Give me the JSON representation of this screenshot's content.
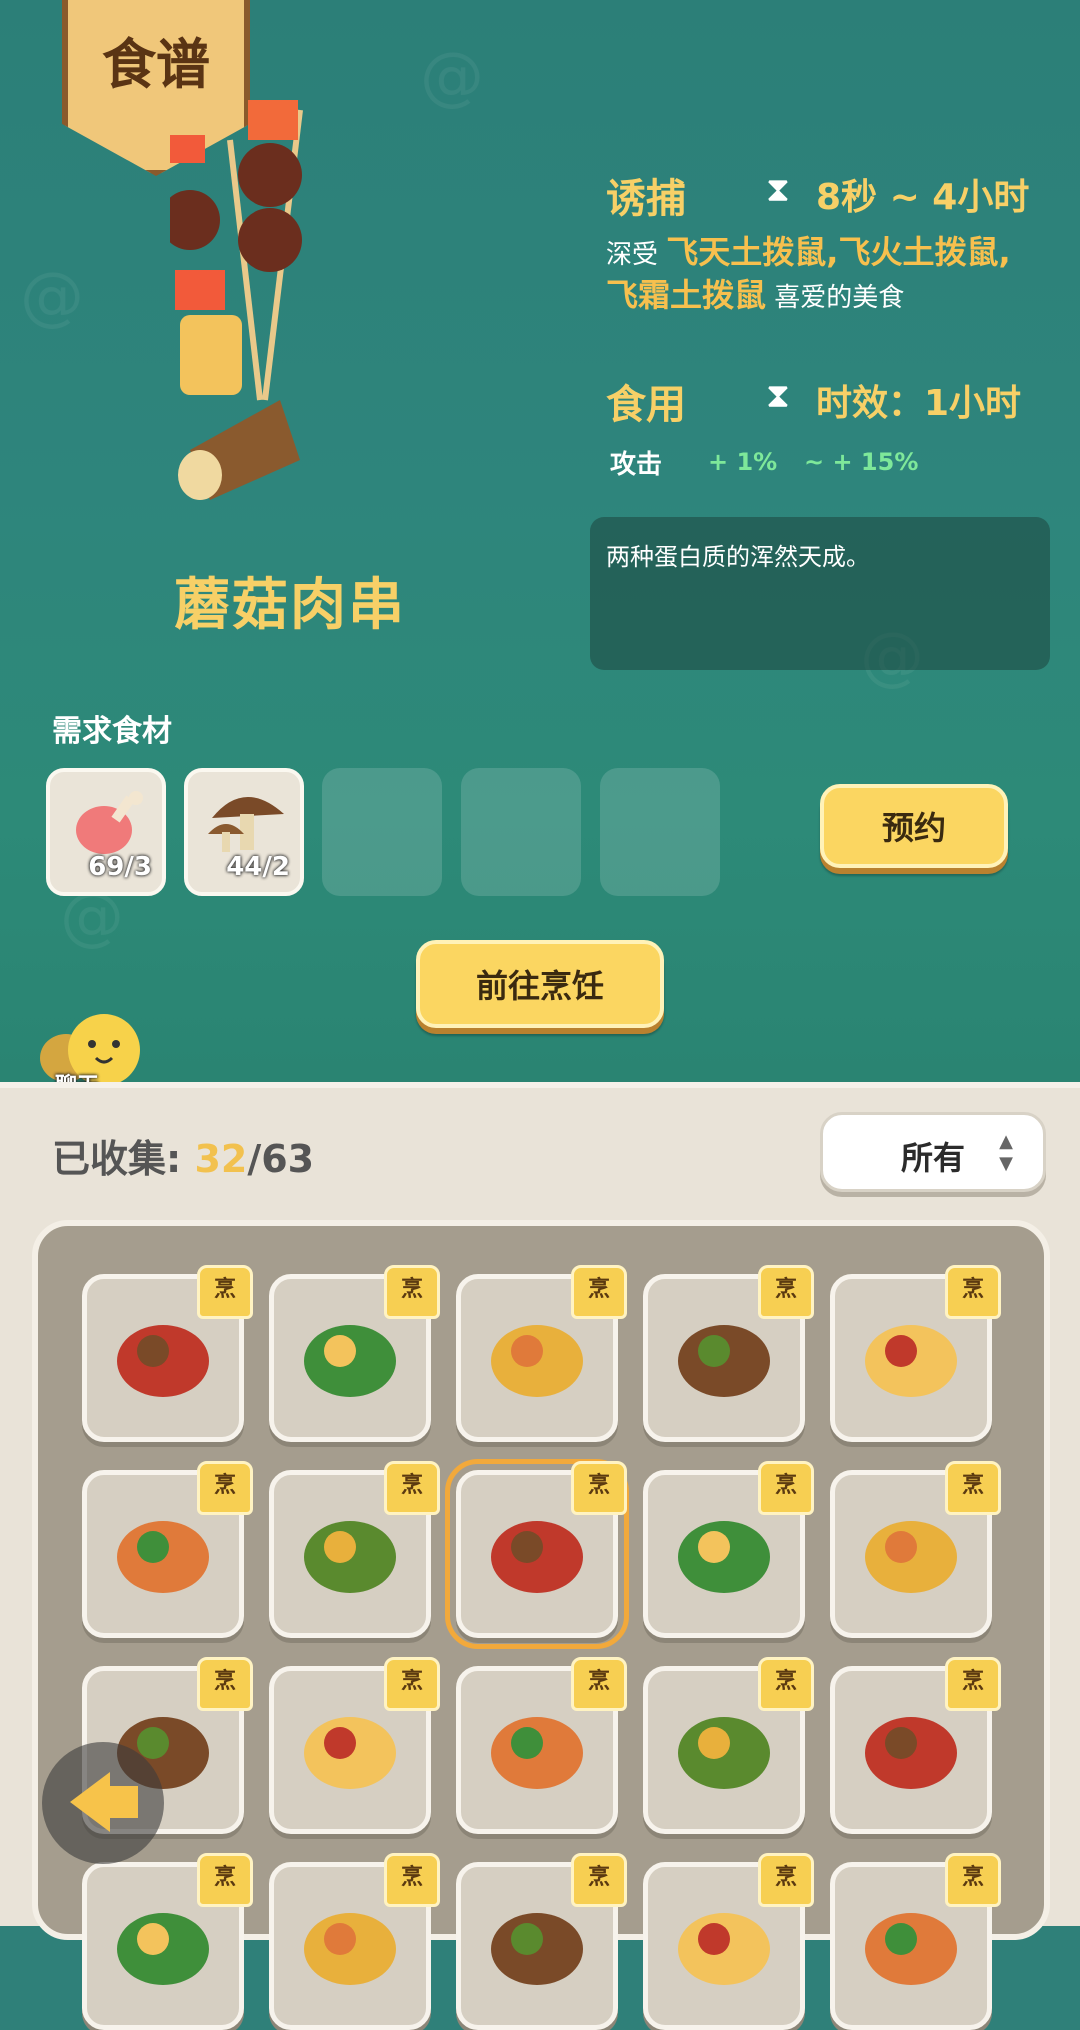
{
  "banner": {
    "title": "食谱"
  },
  "dish": {
    "name": "蘑菇肉串",
    "description": "两种蛋白质的浑然天成。"
  },
  "lure": {
    "title": "诱捕",
    "time": "8秒 ~ 4小时",
    "prefix": "深受",
    "creatures_line1": "飞天土拨鼠,飞火土拨鼠,",
    "creatures_line2": "飞霜土拨鼠",
    "suffix": "喜爱的美食"
  },
  "eat": {
    "title": "食用",
    "duration": "时效：1小时",
    "stat_label": "攻击",
    "stat_min": "+ 1%",
    "stat_max": "~ + 15%"
  },
  "ingredients": {
    "label": "需求食材",
    "items": [
      {
        "icon": "meat-icon",
        "count": "69/3"
      },
      {
        "icon": "mushroom-icon",
        "count": "44/2"
      }
    ]
  },
  "buttons": {
    "reserve": "预约",
    "go_cook": "前往烹饪"
  },
  "chat": {
    "label": "聊天"
  },
  "collection": {
    "label": "已收集: ",
    "collected": "32",
    "total": "/63"
  },
  "filter": {
    "value": "所有"
  },
  "badge": {
    "text": "烹"
  },
  "grid_items": [
    "skewer-mixed-icon",
    "skewer-veg-icon",
    "egg-bowl-icon",
    "fish-skewer-icon",
    "fried-eggs-icon",
    "stew-plate-icon",
    "veg-platter-icon",
    "mushroom-skewer-icon",
    "pepper-salad-icon",
    "soup-plate-icon",
    "fish-greens-icon",
    "tomato-plate-icon",
    "grilled-meat-icon",
    "ham-icon",
    "seafood-plate-icon",
    "dish-16-icon",
    "dish-17-icon",
    "dish-18-icon",
    "dish-19-icon",
    "dish-20-icon"
  ],
  "colors": {
    "accent": "#f7d067",
    "highlight": "#f7c04e",
    "stat_green": "#7ee89a",
    "selection": "#f2a93b"
  }
}
